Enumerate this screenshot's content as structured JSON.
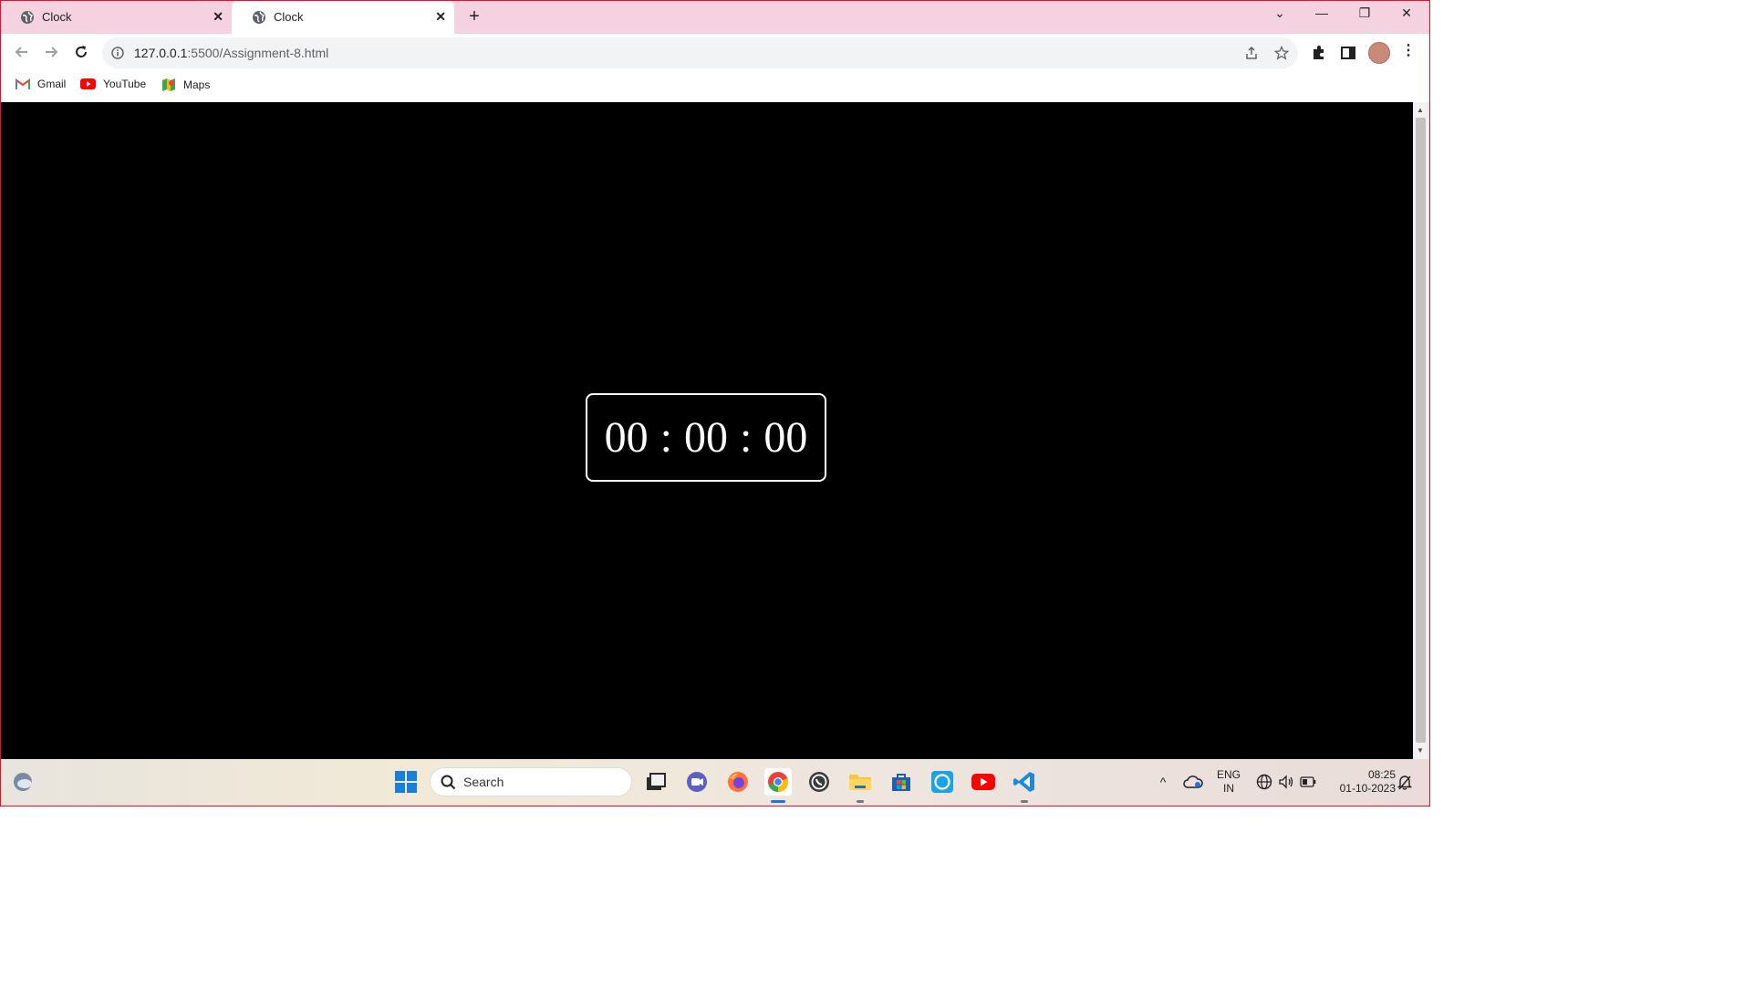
{
  "browser": {
    "tabs": [
      {
        "title": "Clock",
        "active": false
      },
      {
        "title": "Clock",
        "active": true
      }
    ],
    "url_host": "127.0.0.1",
    "url_rest": ":5500/Assignment-8.html",
    "bookmarks": [
      {
        "label": "Gmail",
        "icon": "gmail-icon"
      },
      {
        "label": "YouTube",
        "icon": "youtube-icon"
      },
      {
        "label": "Maps",
        "icon": "maps-icon"
      }
    ]
  },
  "clock": {
    "hours": "00",
    "separator": ":",
    "minutes": "00",
    "seconds": "00"
  },
  "taskbar": {
    "search_label": "Search",
    "lang_top": "ENG",
    "lang_bottom": "IN",
    "time": "08:25",
    "date": "01-10-2023"
  },
  "colors": {
    "tabstrip": "#f5d2e0",
    "content_bg": "#000000",
    "clock_text": "#ffffff"
  }
}
